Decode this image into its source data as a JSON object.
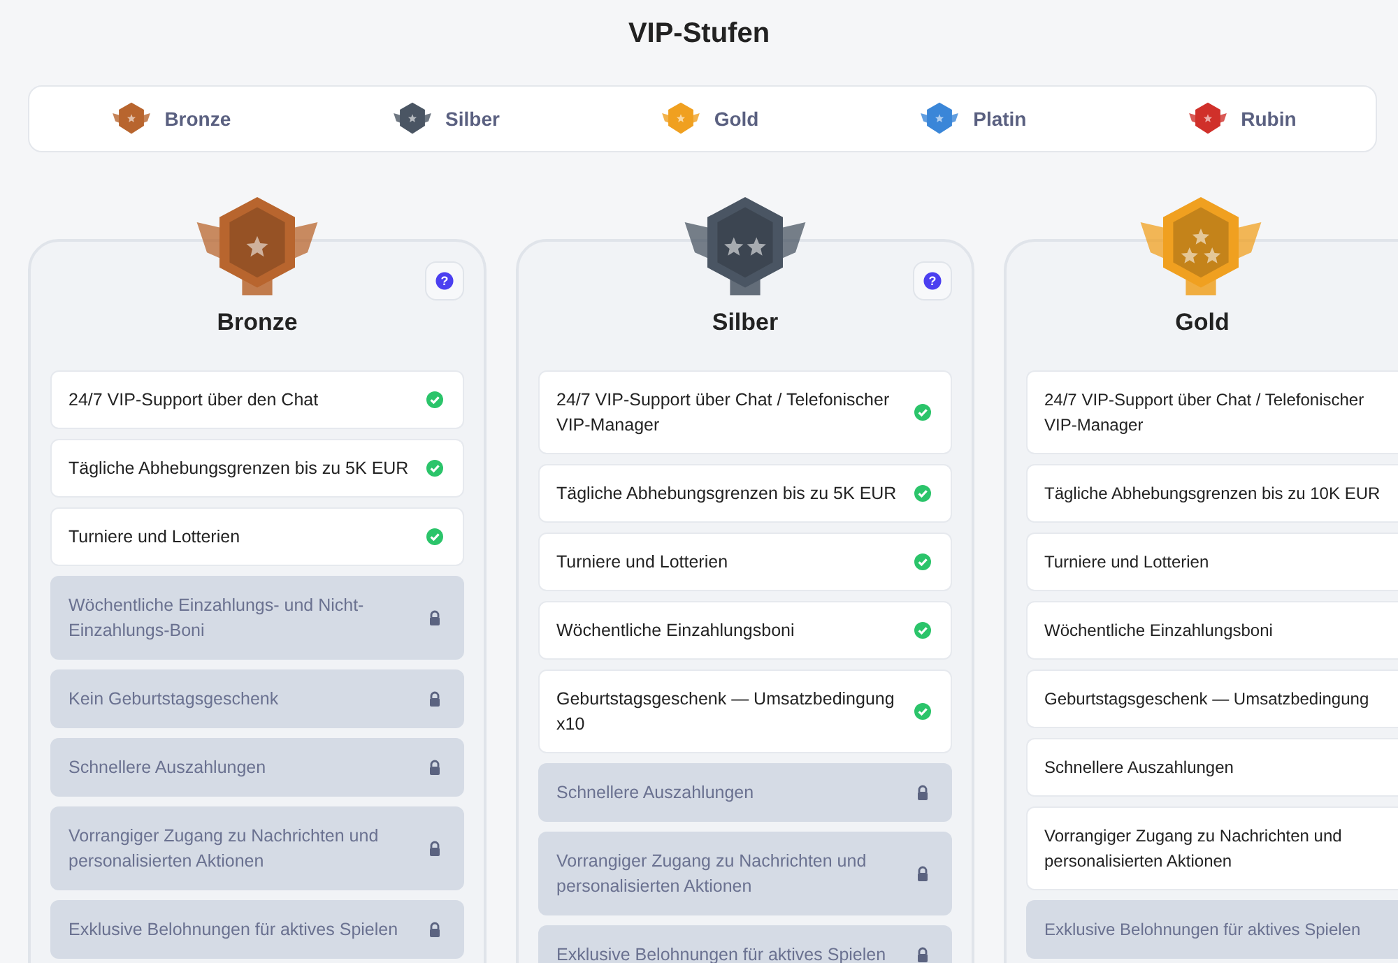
{
  "title": "VIP-Stufen",
  "tabs": [
    {
      "label": "Bronze",
      "color": "#b8652e"
    },
    {
      "label": "Silber",
      "color": "#4a5563"
    },
    {
      "label": "Gold",
      "color": "#f0a020"
    },
    {
      "label": "Platin",
      "color": "#3a86d8"
    },
    {
      "label": "Rubin",
      "color": "#d0302a"
    }
  ],
  "tiers": [
    {
      "name": "Bronze",
      "color": "#b8652e",
      "help": "?",
      "cut_off": false,
      "perks": [
        {
          "text": "24/7 VIP-Support über den Chat",
          "unlocked": true
        },
        {
          "text": "Tägliche Abhebungsgrenzen bis zu 5K EUR",
          "unlocked": true
        },
        {
          "text": "Turniere und Lotterien",
          "unlocked": true
        },
        {
          "text": "Wöchentliche Einzahlungs- und Nicht-Einzahlungs-Boni",
          "unlocked": false
        },
        {
          "text": "Kein Geburtstagsgeschenk",
          "unlocked": false
        },
        {
          "text": "Schnellere Auszahlungen",
          "unlocked": false
        },
        {
          "text": "Vorrangiger Zugang zu Nachrichten und personalisierten Aktionen",
          "unlocked": false
        },
        {
          "text": "Exklusive Belohnungen für aktives Spielen",
          "unlocked": false
        }
      ]
    },
    {
      "name": "Silber",
      "color": "#4a5563",
      "help": "?",
      "cut_off": false,
      "perks": [
        {
          "text": "24/7 VIP-Support über Chat / Telefonischer VIP-Manager",
          "unlocked": true
        },
        {
          "text": "Tägliche Abhebungsgrenzen bis zu 5K EUR",
          "unlocked": true
        },
        {
          "text": "Turniere und Lotterien",
          "unlocked": true
        },
        {
          "text": "Wöchentliche Einzahlungsboni",
          "unlocked": true
        },
        {
          "text": "Geburtstagsgeschenk — Umsatzbedingung x10",
          "unlocked": true
        },
        {
          "text": "Schnellere Auszahlungen",
          "unlocked": false
        },
        {
          "text": "Vorrangiger Zugang zu Nachrichten und personalisierten Aktionen",
          "unlocked": false
        },
        {
          "text": "Exklusive Belohnungen für aktives Spielen",
          "unlocked": false
        }
      ]
    },
    {
      "name": "Gold",
      "color": "#f0a020",
      "cut_off": true,
      "perks": [
        {
          "text": "24/7 VIP-Support über Chat / Telefonischer VIP-Manager",
          "unlocked": true
        },
        {
          "text": "Tägliche Abhebungsgrenzen bis zu 10K EUR",
          "unlocked": true
        },
        {
          "text": "Turniere und Lotterien",
          "unlocked": true
        },
        {
          "text": "Wöchentliche Einzahlungsboni",
          "unlocked": true
        },
        {
          "text": "Geburtstagsgeschenk — Umsatzbedingung",
          "unlocked": true
        },
        {
          "text": "Schnellere Auszahlungen",
          "unlocked": true
        },
        {
          "text": "Vorrangiger Zugang zu Nachrichten und personalisierten Aktionen",
          "unlocked": true
        },
        {
          "text": "Exklusive Belohnungen für aktives Spielen",
          "unlocked": false
        }
      ]
    }
  ]
}
